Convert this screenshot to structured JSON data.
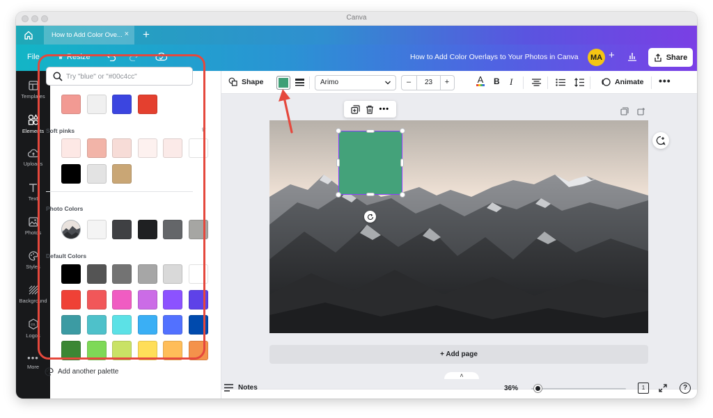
{
  "window": {
    "title": "Canva"
  },
  "tabs": [
    {
      "label": "How to Add Color Ove..."
    }
  ],
  "menubar": {
    "file_label": "File",
    "resize_label": "Resize",
    "document_title": "How to Add Color Overlays to Your Photos in Canva",
    "avatar_initials": "MA",
    "share_label": "Share"
  },
  "left_rail": [
    {
      "label": "Templates",
      "icon": "templates-icon"
    },
    {
      "label": "Elements",
      "icon": "elements-icon",
      "active": true
    },
    {
      "label": "Uploads",
      "icon": "uploads-icon"
    },
    {
      "label": "Text",
      "icon": "text-icon"
    },
    {
      "label": "Photos",
      "icon": "photos-icon"
    },
    {
      "label": "Styles",
      "icon": "styles-icon"
    },
    {
      "label": "Background",
      "icon": "background-icon"
    },
    {
      "label": "Logos",
      "icon": "logos-icon"
    },
    {
      "label": "More",
      "icon": "more-icon"
    }
  ],
  "color_panel": {
    "search_placeholder": "Try \"blue\" or \"#00c4cc\"",
    "partial_row": [
      "#f29a93",
      "#f0f0f0",
      "#3b45e0",
      "#e4402f"
    ],
    "soft_pinks": {
      "title": "Soft pinks",
      "colors": [
        "#fde8e5",
        "#f2b4a8",
        "#f7dcd7",
        "#fdf1ef",
        "#fbeae8",
        "#ffffff",
        "#000000",
        "#e3e3e3",
        "#c9a675"
      ]
    },
    "photo_colors": {
      "title": "Photo Colors",
      "colors": [
        "#f4f4f4",
        "#3f4043",
        "#1f2022",
        "#646669",
        "#a6a6a3"
      ]
    },
    "default_colors": {
      "title": "Default Colors",
      "colors": [
        "#000000",
        "#545454",
        "#737373",
        "#a6a6a6",
        "#d9d9d9",
        "#ffffff",
        "#ef4136",
        "#f15759",
        "#f05cc2",
        "#cb6ce6",
        "#8c52ff",
        "#5e42e8",
        "#3c9ba3",
        "#4ec1ca",
        "#5ce1e6",
        "#3aaff5",
        "#5271ff",
        "#004aad",
        "#3b8734",
        "#7ed957",
        "#c9e265",
        "#ffde59",
        "#ffbd59",
        "#f4924b"
      ]
    },
    "add_palette_label": "Add another palette"
  },
  "toolbar": {
    "shape_label": "Shape",
    "selected_color": "#3f9f76",
    "font": "Arimo",
    "font_size": "23",
    "animate_label": "Animate"
  },
  "canvas": {
    "shape_color": "#44a27a",
    "add_page_label": "+ Add page"
  },
  "footer": {
    "notes_label": "Notes",
    "zoom": "36%",
    "page_count": "1"
  }
}
